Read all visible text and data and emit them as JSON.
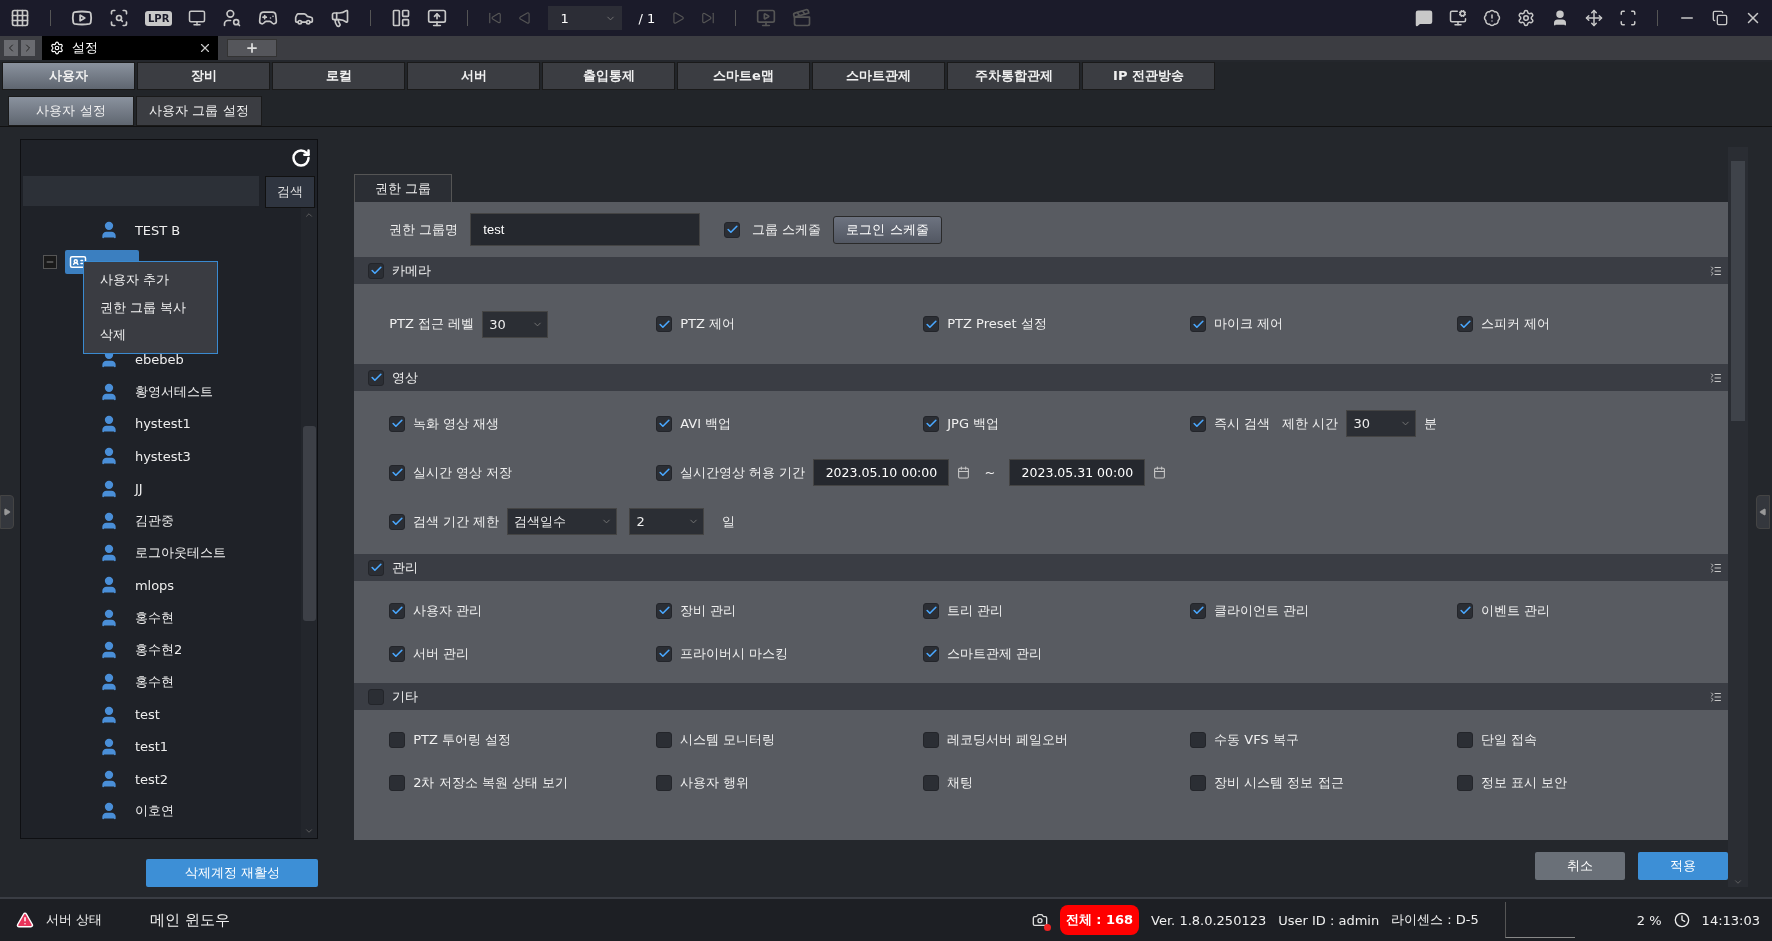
{
  "toolbar": {
    "lpr_label": "LPR",
    "page": "1",
    "page_total": "/ 1"
  },
  "document_tab": {
    "title": "설정"
  },
  "main_tabs": [
    {
      "label": "사용자",
      "selected": true
    },
    {
      "label": "장비",
      "selected": false
    },
    {
      "label": "로컬",
      "selected": false
    },
    {
      "label": "서버",
      "selected": false
    },
    {
      "label": "출입통제",
      "selected": false
    },
    {
      "label": "스마트e맵",
      "selected": false
    },
    {
      "label": "스마트관제",
      "selected": false
    },
    {
      "label": "주차통합관제",
      "selected": false
    },
    {
      "label": "IP 전관방송",
      "selected": false
    }
  ],
  "sub_tabs": [
    {
      "label": "사용자 설정",
      "selected": true
    },
    {
      "label": "사용자 그룹 설정",
      "selected": false
    }
  ],
  "user_tree": {
    "search_button": "검색",
    "items": [
      {
        "kind": "user",
        "name": "TEST B"
      },
      {
        "kind": "group",
        "expanded": true,
        "selected": true,
        "children": [
          {
            "kind": "user",
            "name": "ebebeb"
          },
          {
            "kind": "user",
            "name": "황영서테스트"
          },
          {
            "kind": "user",
            "name": "hystest1"
          },
          {
            "kind": "user",
            "name": "hystest3"
          },
          {
            "kind": "user",
            "name": "JJ"
          },
          {
            "kind": "user",
            "name": "김관중"
          },
          {
            "kind": "user",
            "name": "로그아웃테스트"
          },
          {
            "kind": "user",
            "name": "mlops"
          },
          {
            "kind": "user",
            "name": "홍수현"
          },
          {
            "kind": "user",
            "name": "홍수현2"
          },
          {
            "kind": "user",
            "name": "홍수현"
          },
          {
            "kind": "user",
            "name": "test"
          },
          {
            "kind": "user",
            "name": "test1"
          },
          {
            "kind": "user",
            "name": "test2"
          },
          {
            "kind": "user",
            "name": "이호연"
          }
        ]
      }
    ]
  },
  "context_menu": [
    "사용자 추가",
    "권한 그룹 복사",
    "삭제"
  ],
  "restore_button": "삭제계정 재활성",
  "permission_panel": {
    "tab": "권한 그룹",
    "name_label": "권한 그룹명",
    "name_value": "test",
    "schedule": {
      "label": "그룹 스케줄",
      "checked": true
    },
    "login_schedule_button": "로그인 스케줄",
    "sections": [
      {
        "title": "카메라",
        "checked": true,
        "rows": [
          [
            {
              "kind": "select",
              "label": "PTZ 접근 레벨",
              "value": "30"
            },
            {
              "kind": "check",
              "label": "PTZ 제어",
              "checked": true
            },
            {
              "kind": "check",
              "label": "PTZ Preset 설정",
              "checked": true
            },
            {
              "kind": "check",
              "label": "마이크 제어",
              "checked": true
            },
            {
              "kind": "check",
              "label": "스피커 제어",
              "checked": true
            }
          ]
        ]
      },
      {
        "title": "영상",
        "checked": true,
        "rows": [
          [
            {
              "kind": "check",
              "label": "녹화 영상 재생",
              "checked": true
            },
            {
              "kind": "check",
              "label": "AVI 백업",
              "checked": true
            },
            {
              "kind": "check",
              "label": "JPG 백업",
              "checked": true
            },
            {
              "kind": "check_limit",
              "label": "즉시 검색",
              "checked": true,
              "sub_label": "제한 시간",
              "value": "30",
              "unit": "분"
            }
          ],
          [
            {
              "kind": "check",
              "label": "실시간 영상 저장",
              "checked": true
            },
            {
              "kind": "check_period",
              "label": "실시간영상 허용 기간",
              "checked": true,
              "from": "2023.05.10 00:00",
              "separator": "~",
              "to": "2023.05.31 00:00"
            }
          ],
          [
            {
              "kind": "check_range",
              "label": "검색 기간 제한",
              "checked": true,
              "mode": "검색일수",
              "value": "2",
              "unit": "일"
            }
          ]
        ]
      },
      {
        "title": "관리",
        "checked": true,
        "rows": [
          [
            {
              "kind": "check",
              "label": "사용자 관리",
              "checked": true
            },
            {
              "kind": "check",
              "label": "장비 관리",
              "checked": true
            },
            {
              "kind": "check",
              "label": "트리 관리",
              "checked": true
            },
            {
              "kind": "check",
              "label": "클라이언트 관리",
              "checked": true
            },
            {
              "kind": "check",
              "label": "이벤트 관리",
              "checked": true
            }
          ],
          [
            {
              "kind": "check",
              "label": "서버 관리",
              "checked": true
            },
            {
              "kind": "check",
              "label": "프라이버시 마스킹",
              "checked": true
            },
            {
              "kind": "check",
              "label": "스마트관제 관리",
              "checked": true
            }
          ]
        ]
      },
      {
        "title": "기타",
        "checked": false,
        "rows": [
          [
            {
              "kind": "check",
              "label": "PTZ 투어링 설정",
              "checked": false
            },
            {
              "kind": "check",
              "label": "시스템 모니터링",
              "checked": false
            },
            {
              "kind": "check",
              "label": "레코딩서버 페일오버",
              "checked": false
            },
            {
              "kind": "check",
              "label": "수동 VFS 복구",
              "checked": false
            },
            {
              "kind": "check",
              "label": "단일 접속",
              "checked": false
            }
          ],
          [
            {
              "kind": "check",
              "label": "2차 저장소 복원 상태 보기",
              "checked": false
            },
            {
              "kind": "check",
              "label": "사용자 행위",
              "checked": false
            },
            {
              "kind": "check",
              "label": "채팅",
              "checked": false
            },
            {
              "kind": "check",
              "label": "장비 시스템 정보 접근",
              "checked": false
            },
            {
              "kind": "check",
              "label": "정보 표시 보안",
              "checked": false
            }
          ]
        ]
      }
    ]
  },
  "actions": [
    {
      "label": "취소",
      "kind": "secondary"
    },
    {
      "label": "적용",
      "kind": "primary"
    }
  ],
  "status_bar": {
    "server_status": "서버 상태",
    "window_name": "메인 윈도우",
    "total": "전체 : 168",
    "version": "Ver. 1.8.0.250123",
    "user": "User ID : admin",
    "license": "라이센스 : D-5",
    "cpu": "2 %",
    "time": "14:13:03"
  }
}
